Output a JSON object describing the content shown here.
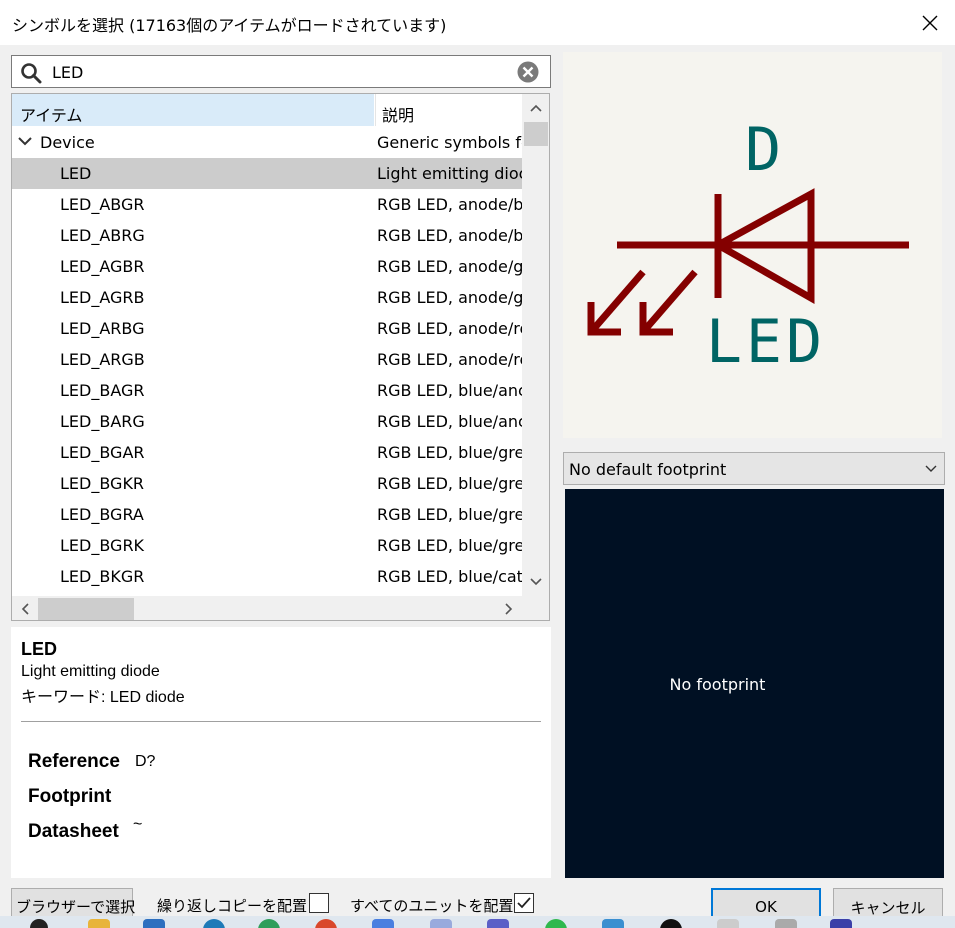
{
  "window": {
    "title": "シンボルを選択 (17163個のアイテムがロードされています)",
    "close_icon": "close-icon"
  },
  "search": {
    "value": "LED",
    "icon": "search-icon",
    "clear_icon": "clear-icon"
  },
  "tree": {
    "col_item": "アイテム",
    "col_desc": "説明",
    "group": {
      "name": "Device",
      "desc": "Generic symbols fo",
      "expanded": true
    },
    "rows": [
      {
        "name": "LED",
        "desc": "Light emitting dioc",
        "selected": true
      },
      {
        "name": "LED_ABGR",
        "desc": "RGB LED, anode/b"
      },
      {
        "name": "LED_ABRG",
        "desc": "RGB LED, anode/b"
      },
      {
        "name": "LED_AGBR",
        "desc": "RGB LED, anode/g"
      },
      {
        "name": "LED_AGRB",
        "desc": "RGB LED, anode/g"
      },
      {
        "name": "LED_ARBG",
        "desc": "RGB LED, anode/re"
      },
      {
        "name": "LED_ARGB",
        "desc": "RGB LED, anode/re"
      },
      {
        "name": "LED_BAGR",
        "desc": "RGB LED, blue/anc"
      },
      {
        "name": "LED_BARG",
        "desc": "RGB LED, blue/anc"
      },
      {
        "name": "LED_BGAR",
        "desc": "RGB LED, blue/gre"
      },
      {
        "name": "LED_BGKR",
        "desc": "RGB LED, blue/gre"
      },
      {
        "name": "LED_BGRA",
        "desc": "RGB LED, blue/gre"
      },
      {
        "name": "LED_BGRK",
        "desc": "RGB LED, blue/gre"
      },
      {
        "name": "LED_BKGR",
        "desc": "RGB LED, blue/cath"
      }
    ]
  },
  "info": {
    "name": "LED",
    "description": "Light emitting diode",
    "keywords": "キーワード: LED diode",
    "fields": [
      {
        "label": "Reference",
        "value": "D?"
      },
      {
        "label": "Footprint",
        "value": ""
      },
      {
        "label": "Datasheet",
        "value": "~"
      }
    ]
  },
  "symbol_preview": {
    "reference": "D",
    "value": "LED",
    "body_color": "#840000",
    "text_color": "#006464",
    "background": "#f5f4ef"
  },
  "footprint": {
    "selected": "No default footprint",
    "empty_text": "No footprint",
    "background": "#001023"
  },
  "buttons": {
    "browse": "ブラウザーで選択",
    "repeat_copy": "繰り返しコピーを配置",
    "repeat_checked": false,
    "all_units": "すべてのユニットを配置",
    "all_units_checked": true,
    "ok": "OK",
    "cancel": "キャンセル"
  },
  "taskbar": {
    "icons": [
      "search-icon",
      "folder-icon",
      "store-icon",
      "browser-icon",
      "chrome-icon",
      "app-icon",
      "chat-icon",
      "lock-icon",
      "teams-icon",
      "line-icon",
      "settings-icon",
      "github-icon",
      "file-icon",
      "app-icon-2",
      "kicad-icon"
    ]
  }
}
